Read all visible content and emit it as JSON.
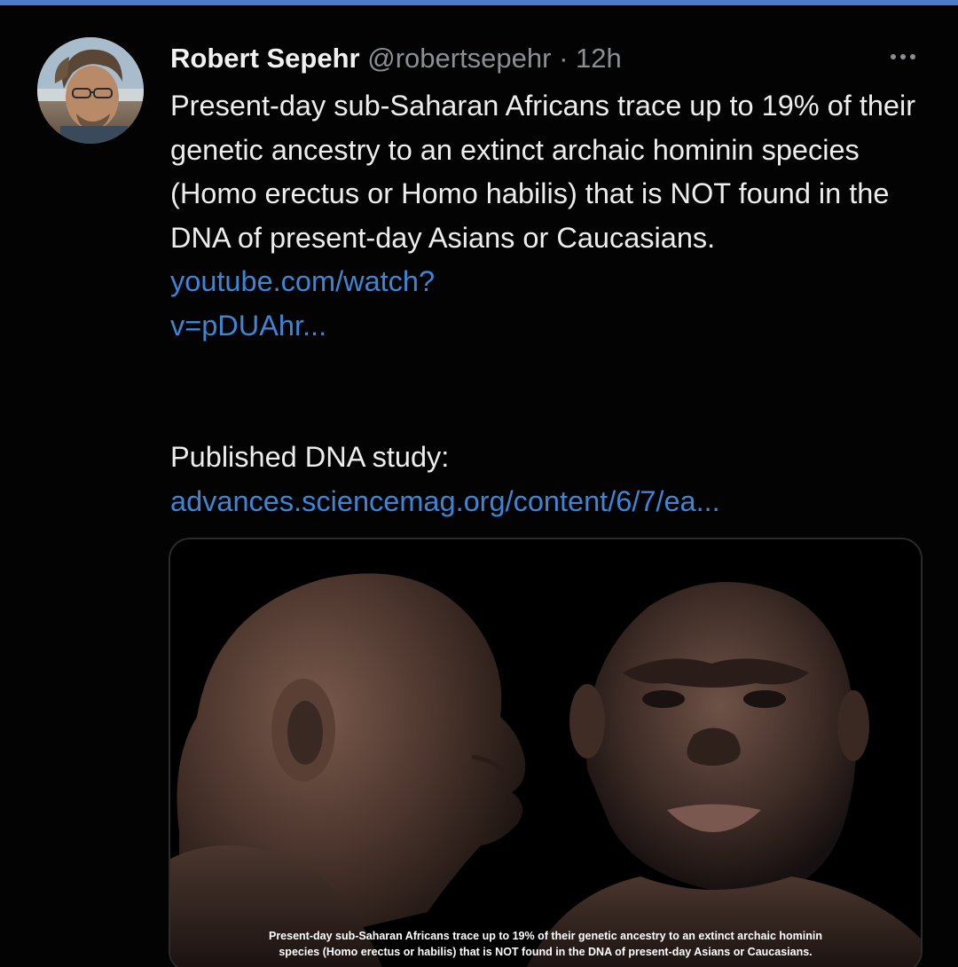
{
  "tweet": {
    "author_name": "Robert Sepehr",
    "handle": "@robertsepehr",
    "separator": " · ",
    "time": "12h",
    "more_icon": "ellipsis-icon",
    "text_part1": "Present-day sub-Saharan Africans trace up to 19% of their genetic ancestry to an extinct archaic hominin species (Homo erectus or Homo habilis) that is NOT found in the DNA of present-day Asians or Caucasians. ",
    "link1_line1": "youtube.com/watch?",
    "link1_line2": "v=pDUAhr...",
    "text_part2": "Published DNA study:",
    "link2": "advances.sciencemag.org/content/6/7/ea...",
    "image": {
      "caption_line1": "Present-day sub-Saharan Africans trace up to 19% of their genetic ancestry to an extinct archaic hominin",
      "caption_line2": "species (Homo erectus or habilis) that is NOT found in the DNA of present-day Asians or Caucasians."
    }
  },
  "colors": {
    "link": "#3d86d6",
    "handle": "#8b8f94",
    "background": "#030303",
    "top_strip": "#4a7ccc"
  }
}
